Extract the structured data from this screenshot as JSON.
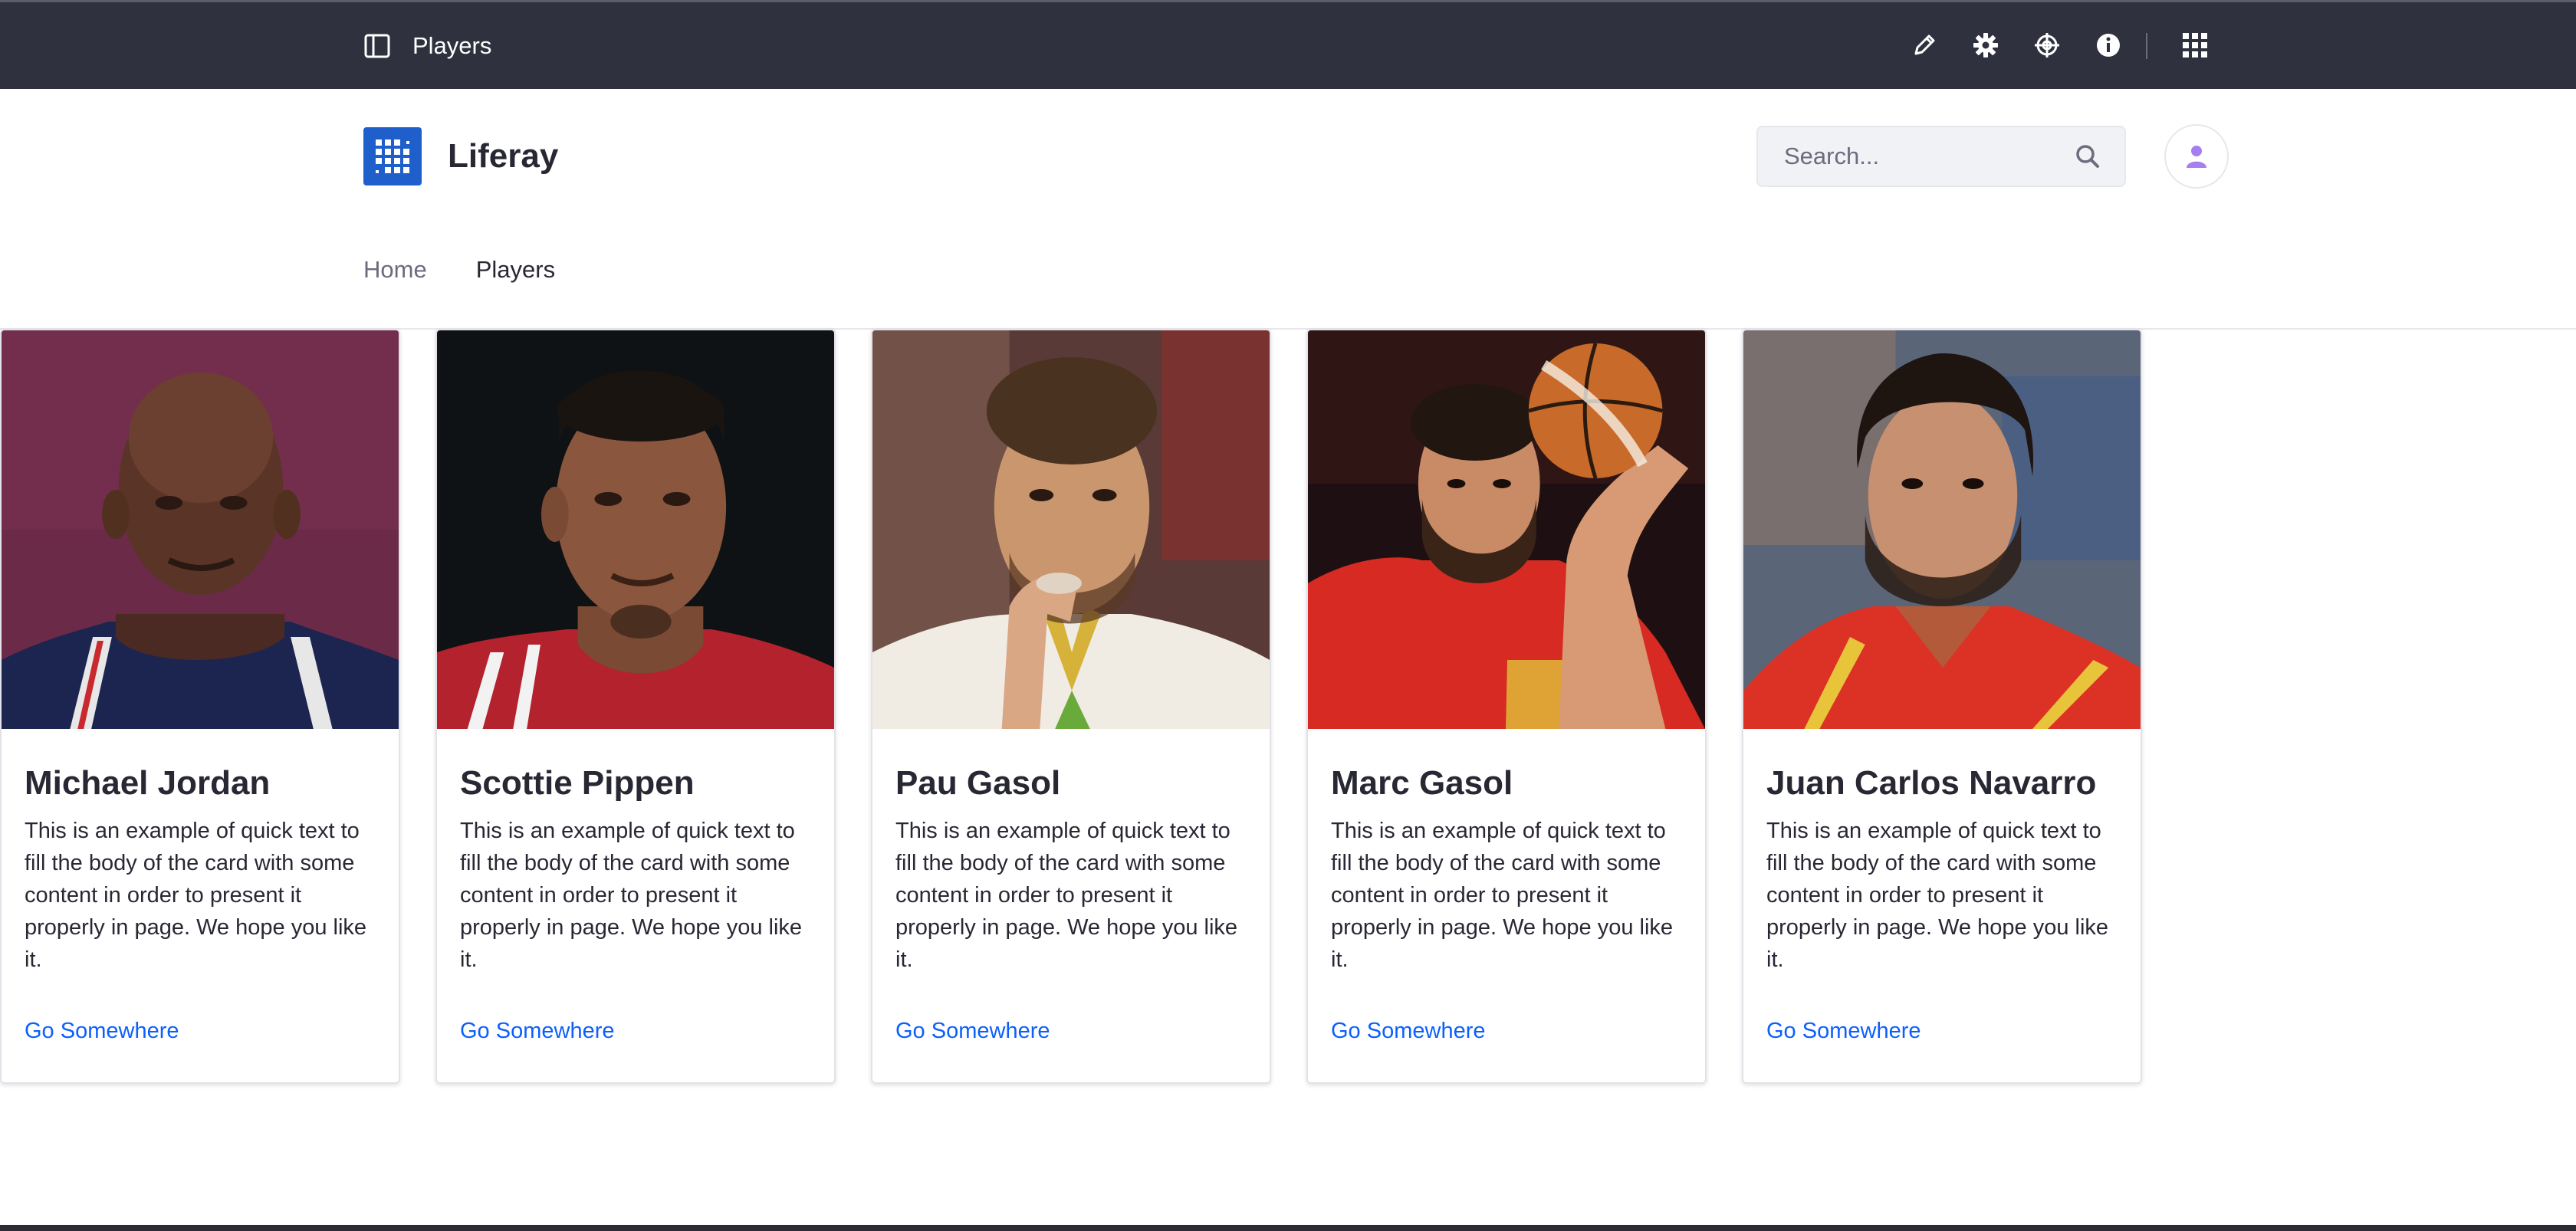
{
  "control_menu": {
    "title": "Players",
    "icons": [
      "sidebar-toggle-icon",
      "pencil-icon",
      "gear-icon",
      "simulation-icon",
      "info-icon",
      "apps-grid-icon"
    ]
  },
  "site": {
    "name": "Liferay"
  },
  "search": {
    "placeholder": "Search..."
  },
  "nav": {
    "items": [
      {
        "label": "Home"
      },
      {
        "label": "Players"
      }
    ]
  },
  "cards": [
    {
      "name": "Michael Jordan",
      "text": "This is an example of quick text to fill the body of the card with some content in order to present it properly in page. We hope you like it.",
      "link": "Go Somewhere"
    },
    {
      "name": "Scottie Pippen",
      "text": "This is an example of quick text to fill the body of the card with some content in order to present it properly in page. We hope you like it.",
      "link": "Go Somewhere"
    },
    {
      "name": "Pau Gasol",
      "text": "This is an example of quick text to fill the body of the card with some content in order to present it properly in page. We hope you like it.",
      "link": "Go Somewhere"
    },
    {
      "name": "Marc Gasol",
      "text": "This is an example of quick text to fill the body of the card with some content in order to present it properly in page. We hope you like it.",
      "link": "Go Somewhere"
    },
    {
      "name": "Juan Carlos Navarro",
      "text": "This is an example of quick text to fill the body of the card with some content in order to present it properly in page. We hope you like it.",
      "link": "Go Somewhere"
    }
  ],
  "colors": {
    "control_menu_bg": "#30313f",
    "brand": "#1f5fcc",
    "link": "#0b5fff",
    "avatar_icon": "#a77ef0"
  }
}
